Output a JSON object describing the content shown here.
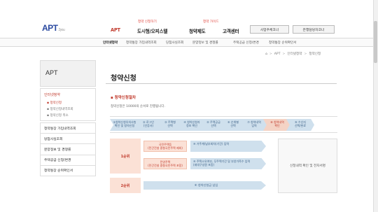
{
  "header": {
    "logo_text": "APT",
    "logo_sub": "2you",
    "nav_hints": [
      "청약 신청하기",
      "청약 가이드"
    ],
    "nav_items": [
      "APT",
      "도시형/오피스텔",
      "청약제도",
      "고객센터"
    ],
    "buttons": [
      "사업주체코너",
      "은행담당자코너"
    ]
  },
  "subnav": {
    "items": [
      "인터넷청약",
      "청약통장 가입내역조회",
      "당첨사실조회",
      "분양정보 및 경쟁률",
      "주택공급 신청/변경",
      "청약통장 순위확인서"
    ]
  },
  "breadcrumb": {
    "home": "⌂",
    "sep": ">",
    "items": [
      "APT",
      "인터넷청약",
      "청약신청"
    ]
  },
  "sidebar": {
    "title": "APT",
    "group_title": "인터넷청약",
    "sub_items": [
      "청약신청",
      "청약신청내역조회",
      "청약신청 취소"
    ],
    "items": [
      "청약통장 가입내역조회",
      "당첨사실조회",
      "분양정보 및 경쟁률",
      "주택공급 신청/변경",
      "청약통장 순위확인서"
    ]
  },
  "content": {
    "title": "청약신청",
    "section": "청약신청절차",
    "description": "청약신청은 10000의 순서로 진행됩니다.",
    "steps": [
      "①청약신청유의사항\n확인 및 청약신청",
      "② 로그인\n(인증서)",
      "③ 주택형\n선택",
      "④ 청약신청자\n정보 확인",
      "⑤ 주택공급\n선택",
      "⑥ 순위별\n선택",
      "⑦ 청약내역\n입력",
      "⑧ 청약내역\n확인",
      "⑨ 수신지\n선택/완료"
    ],
    "rank1": "1순위",
    "rank2": "2순위",
    "priority1": "국민주택등\n(민간건설 중형국민주택 제외)",
    "priority2": "민영주택\n(민간건설 중형국민주택 포함)",
    "flow1": "④ 거주계/납부회차(기간) 입력",
    "flow2": "④ 주택소유여부, 무주택기간 및 부양가족수 입력\n(세대구성원 포함)",
    "flow3": "④ 청약신청금 납입",
    "final": "신청내역 확인 및 전자서명"
  }
}
